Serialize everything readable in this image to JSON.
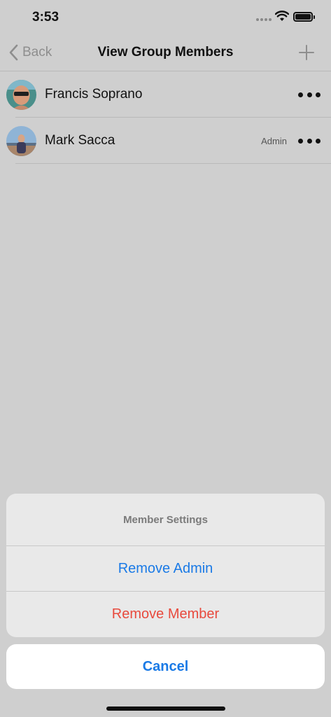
{
  "status_bar": {
    "time": "3:53",
    "icons": [
      "cellular-signal-icon",
      "wifi-icon",
      "battery-icon"
    ]
  },
  "nav": {
    "back_label": "Back",
    "title": "View Group Members",
    "icons": [
      "chevron-left-icon",
      "plus-icon"
    ]
  },
  "members": [
    {
      "name": "Francis Soprano",
      "badge": ""
    },
    {
      "name": "Mark Sacca",
      "badge": "Admin"
    }
  ],
  "action_sheet": {
    "title": "Member Settings",
    "actions": [
      {
        "label": "Remove Admin"
      },
      {
        "label": "Remove Member"
      }
    ],
    "cancel_label": "Cancel"
  },
  "colors": {
    "accent_blue": "#1a7ae6",
    "destructive_red": "#e84a3d",
    "dimmed_background": "#cfcfcf"
  }
}
